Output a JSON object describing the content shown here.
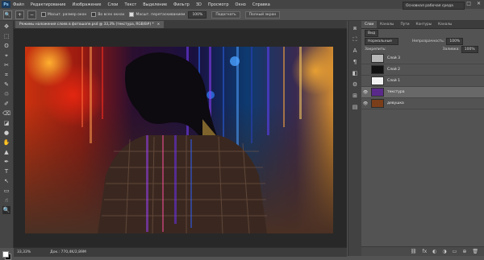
{
  "app": {
    "logo": "Ps"
  },
  "menu": [
    "Файл",
    "Редактирование",
    "Изображение",
    "Слои",
    "Текст",
    "Выделение",
    "Фильтр",
    "3D",
    "Просмотр",
    "Окно",
    "Справка"
  ],
  "window_controls": {
    "minimize": "—",
    "restore": "□",
    "close": "✕"
  },
  "options": {
    "tool_icon": "🔍",
    "zoom_in": "+",
    "zoom_out": "−",
    "check_resize": "Масшт. размер окон",
    "check_all": "Во всех окнах",
    "check_scrubby": "Масшт. перетаскиванием",
    "zoom_value": "100%",
    "fit_button": "Подогнать",
    "fill_button": "Полный экран",
    "workspace": "Основная рабочая среда"
  },
  "document": {
    "tab_title": "Режимы наложения слоев в фотошопе.psd @ 33,3% (текстура, RGB/8#) *",
    "tab_close": "×",
    "zoom": "33,33%",
    "doc_info": "Док.: 770,4K/2,89M"
  },
  "tools": [
    "✥",
    "⬚",
    "ʘ",
    "⌖",
    "✂",
    "⌗",
    "✎",
    "♲",
    "✐",
    "⌫",
    "◪",
    "●",
    "✋",
    "▲",
    "✒",
    "T",
    "↖",
    "▭",
    "☝",
    "🔍"
  ],
  "panel_strip_icons": [
    "⧈",
    "⛶",
    "A",
    "¶",
    "◧",
    "⚙",
    "⊞",
    "▤"
  ],
  "layers_panel": {
    "tabs": [
      "Слои",
      "Каналы",
      "Пути",
      "Контуры",
      "Каналы"
    ],
    "filter": "Вид",
    "blend_mode": "Нормальные",
    "opacity_label": "Непрозрачность:",
    "opacity": "100%",
    "lock_label": "Закрепить:",
    "fill_label": "Заливка:",
    "fill": "100%",
    "layers": [
      {
        "name": "Слой 3",
        "visible": false,
        "thumb": "#b8b8b8",
        "selected": false
      },
      {
        "name": "Слой 2",
        "visible": false,
        "thumb": "#111111",
        "selected": false
      },
      {
        "name": "Слой 1",
        "visible": false,
        "thumb": "#f2f2f2",
        "selected": false
      },
      {
        "name": "текстура",
        "visible": true,
        "thumb": "#5a2a8a",
        "selected": true
      },
      {
        "name": "девушка",
        "visible": true,
        "thumb": "#7a3e1a",
        "selected": false
      }
    ],
    "footer_icons": [
      "⛓",
      "fx",
      "◐",
      "◑",
      "▭",
      "⊕",
      "🗑"
    ]
  },
  "colors": {
    "fg": "#ffffff",
    "bg": "#000000"
  }
}
